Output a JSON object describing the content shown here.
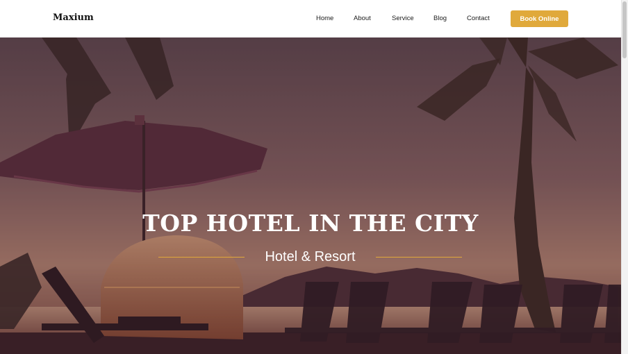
{
  "brand": {
    "name": "Maxium"
  },
  "nav": {
    "items": [
      {
        "label": "Home"
      },
      {
        "label": "About"
      },
      {
        "label": "Service"
      },
      {
        "label": "Blog"
      },
      {
        "label": "Contact"
      }
    ],
    "cta_label": "Book Online"
  },
  "hero": {
    "title": "TOP HOTEL IN THE CITY",
    "subtitle": "Hotel & Resort"
  },
  "colors": {
    "accent": "#e0a93b",
    "nav_background": "#ffffff",
    "hero_overlay": "#4a2a3a"
  },
  "icons": {
    "hero_image": "beach-umbrella-palm-sunset-image"
  }
}
